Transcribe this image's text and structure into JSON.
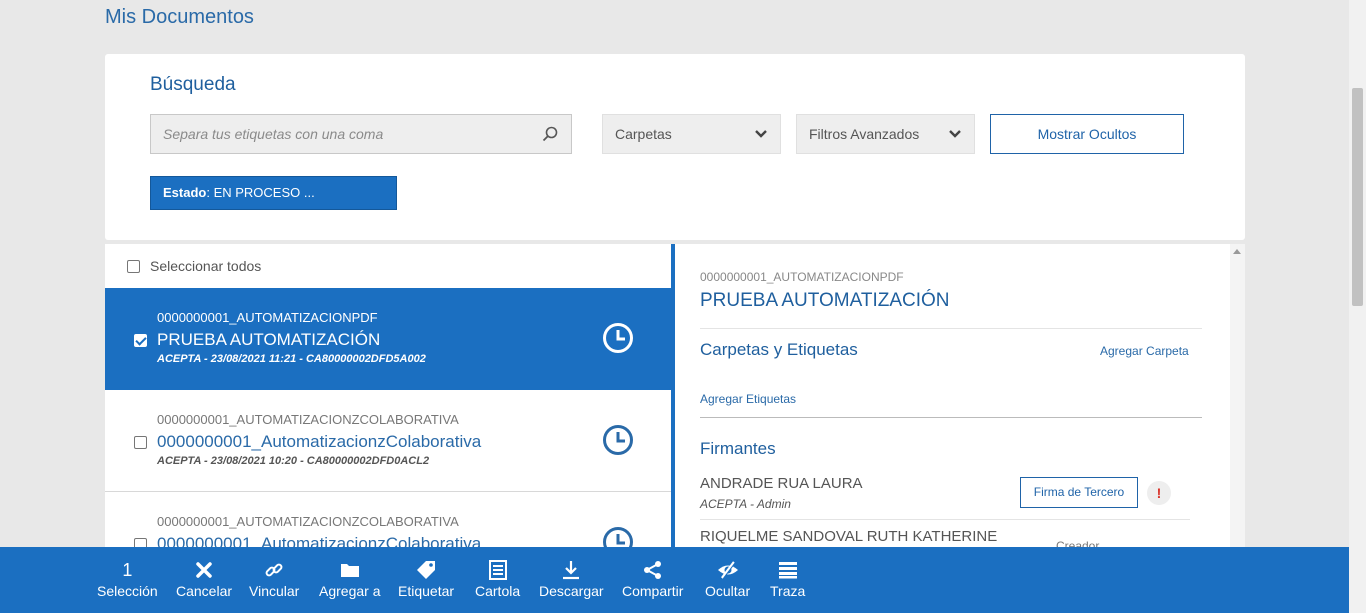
{
  "page": {
    "title": "Mis Documentos"
  },
  "search": {
    "title": "Búsqueda",
    "placeholder": "Separa tus etiquetas con una coma",
    "folders_label": "Carpetas",
    "filters_label": "Filtros Avanzados",
    "show_hidden_label": "Mostrar Ocultos",
    "status_key": "Estado",
    "status_value": ": EN PROCESO ..."
  },
  "list": {
    "select_all_label": "Seleccionar todos",
    "items": [
      {
        "code": "0000000001_AUTOMATIZACIONPDF",
        "name": "PRUEBA AUTOMATIZACIÓN",
        "meta": "ACEPTA - 23/08/2021 11:21 - CA80000002DFD5A002",
        "checked": true
      },
      {
        "code": "0000000001_AUTOMATIZACIONZCOLABORATIVA",
        "name": "0000000001_AutomatizacionzColaborativa",
        "meta": "ACEPTA - 23/08/2021 10:20 - CA80000002DFD0ACL2",
        "checked": false
      },
      {
        "code": "0000000001_AUTOMATIZACIONZCOLABORATIVA",
        "name": "0000000001_AutomatizacionzColaborativa",
        "meta": "",
        "checked": false
      }
    ]
  },
  "detail": {
    "code": "0000000001_AUTOMATIZACIONPDF",
    "title": "PRUEBA AUTOMATIZACIÓN",
    "folders_section": "Carpetas y Etiquetas",
    "add_folder": "Agregar Carpeta",
    "add_tags": "Agregar Etiquetas",
    "signers_section": "Firmantes",
    "signers": [
      {
        "name": "ANDRADE RUA LAURA",
        "role": "ACEPTA - Admin",
        "action": "Firma de Tercero",
        "alert": "!"
      },
      {
        "name": "RIQUELME SANDOVAL RUTH KATHERINE",
        "role": "Creador"
      }
    ]
  },
  "toolbar": {
    "selection_count": "1",
    "selection_label": "Selección",
    "items": [
      {
        "label": "Cancelar",
        "icon": "close-icon"
      },
      {
        "label": "Vincular",
        "icon": "link-icon"
      },
      {
        "label": "Agregar a",
        "icon": "folder-icon"
      },
      {
        "label": "Etiquetar",
        "icon": "tag-icon"
      },
      {
        "label": "Cartola",
        "icon": "document-list-icon"
      },
      {
        "label": "Descargar",
        "icon": "download-icon"
      },
      {
        "label": "Compartir",
        "icon": "share-icon"
      },
      {
        "label": "Ocultar",
        "icon": "eye-slash-icon"
      },
      {
        "label": "Traza",
        "icon": "list-icon"
      }
    ]
  },
  "colors": {
    "primary": "#1b6fc1",
    "link": "#2a6aa8",
    "alert": "#d9342b"
  }
}
